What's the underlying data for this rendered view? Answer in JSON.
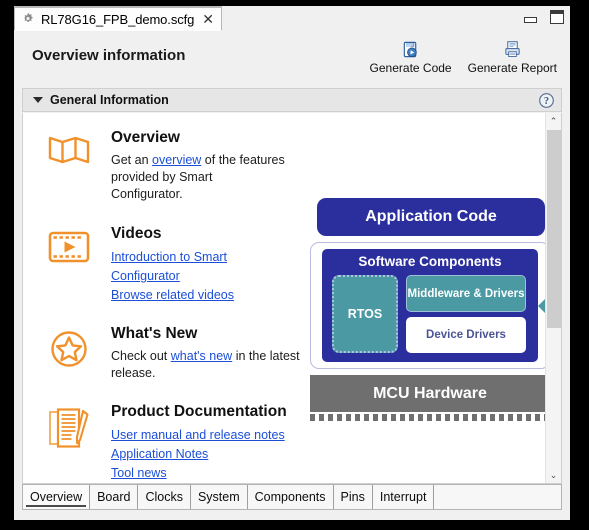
{
  "window": {
    "tab_title": "RL78G16_FPB_demo.scfg",
    "tab_icon": "gear-icon",
    "close_glyph": "✕",
    "minimize_label": "Minimize",
    "maximize_label": "Maximize"
  },
  "header": {
    "title": "Overview information",
    "actions": [
      {
        "label": "Generate Code",
        "icon": "generate-code-icon"
      },
      {
        "label": "Generate Report",
        "icon": "generate-report-icon"
      }
    ]
  },
  "section": {
    "title": "General Information",
    "expanded": true,
    "help_icon": "help-question-icon"
  },
  "blocks": [
    {
      "id": "overview",
      "icon": "map-icon",
      "title": "Overview",
      "text_before": "Get an ",
      "link": "overview",
      "text_after": " of the features provided by Smart Configurator."
    },
    {
      "id": "videos",
      "icon": "video-player-icon",
      "title": "Videos",
      "links": [
        "Introduction to Smart Configurator",
        "Browse related videos"
      ]
    },
    {
      "id": "whats-new",
      "icon": "star-badge-icon",
      "title": "What's New",
      "text_before": "Check out ",
      "link": "what's new",
      "text_after": " in the latest release."
    },
    {
      "id": "product-documentation",
      "icon": "document-pencil-icon",
      "title": "Product Documentation",
      "links": [
        "User manual and release notes",
        "Application Notes",
        "Tool news"
      ]
    }
  ],
  "diagram": {
    "application_code": "Application Code",
    "software_components": "Software Components",
    "rtos": "RTOS",
    "middleware_drivers": "Middleware & Drivers",
    "device_drivers": "Device Drivers",
    "mcu_hardware": "MCU Hardware",
    "arrow_icon": "left-arrow-icon",
    "colors": {
      "indigo": "#2b2f9e",
      "teal": "#4a99a3",
      "gray": "#706f6f",
      "white": "#ffffff",
      "device_drivers_text": "#4b5596"
    }
  },
  "scrollbar": {
    "up_glyph": "⌃",
    "down_glyph": "⌄"
  },
  "bottom_tabs": [
    {
      "label": "Overview",
      "selected": true
    },
    {
      "label": "Board",
      "selected": false
    },
    {
      "label": "Clocks",
      "selected": false
    },
    {
      "label": "System",
      "selected": false
    },
    {
      "label": "Components",
      "selected": false
    },
    {
      "label": "Pins",
      "selected": false
    },
    {
      "label": "Interrupt",
      "selected": false
    }
  ],
  "theme": {
    "link_color": "#1b4fd8",
    "icon_orange": "#f0912b",
    "chrome_gray": "#f0f0f0"
  }
}
